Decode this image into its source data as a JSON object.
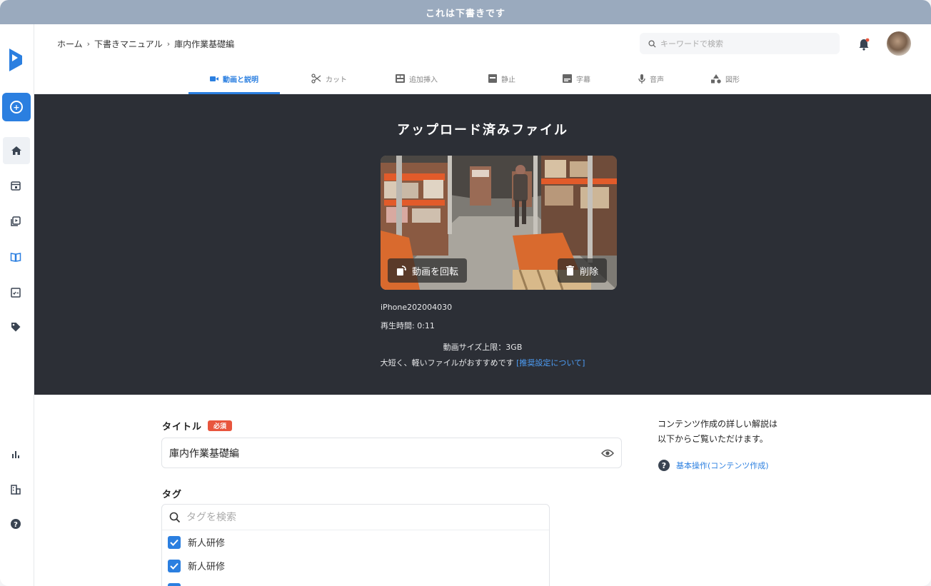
{
  "banner": {
    "text": "これは下書きです"
  },
  "breadcrumb": {
    "items": [
      "ホーム",
      "下書きマニュアル",
      "庫内作業基礎編"
    ]
  },
  "search": {
    "placeholder": "キーワードで検索"
  },
  "tabs": [
    {
      "label": "動画と説明",
      "active": true
    },
    {
      "label": "カット"
    },
    {
      "label": "追加挿入"
    },
    {
      "label": "静止"
    },
    {
      "label": "字幕"
    },
    {
      "label": "音声"
    },
    {
      "label": "図形"
    }
  ],
  "upload": {
    "title": "アップロード済みファイル",
    "rotate_label": "動画を回転",
    "delete_label": "削除",
    "file_name": "iPhone202004030",
    "duration": "再生時間: 0:11",
    "size_limit": "動画サイズ上限：3GB",
    "advice": "大短く、軽いファイルがおすすめです",
    "advice_link": "[推奨設定について]"
  },
  "form": {
    "title_label": "タイトル",
    "required_badge": "必須",
    "title_value": "庫内作業基礎編",
    "tag_label": "タグ",
    "tag_search_placeholder": "タグを検索",
    "tags": [
      "新人研修",
      "新人研修"
    ]
  },
  "help": {
    "line1": "コンテンツ作成の詳しい解説は",
    "line2": "以下からご覧いただけます。",
    "link": "基本操作(コンテンツ作成)"
  },
  "colors": {
    "accent": "#2b7fe0",
    "banner": "#9aaabe",
    "panel": "#2c2f36",
    "required": "#e8553d"
  }
}
